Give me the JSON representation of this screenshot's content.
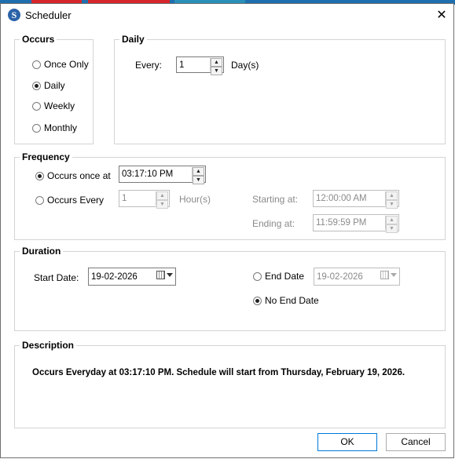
{
  "window": {
    "title": "Scheduler",
    "close_glyph": "✕"
  },
  "occurs": {
    "legend": "Occurs",
    "options": [
      {
        "label": "Once Only",
        "selected": false
      },
      {
        "label": "Daily",
        "selected": true
      },
      {
        "label": "Weekly",
        "selected": false
      },
      {
        "label": "Monthly",
        "selected": false
      }
    ]
  },
  "daily": {
    "legend": "Daily",
    "every_label": "Every:",
    "every_value": "1",
    "unit": "Day(s)"
  },
  "frequency": {
    "legend": "Frequency",
    "once_label": "Occurs once at",
    "once_time": "03:17:10 PM",
    "every_label": "Occurs Every",
    "every_value": "1",
    "every_unit": "Hour(s)",
    "starting_label": "Starting at:",
    "starting_value": "12:00:00 AM",
    "ending_label": "Ending at:",
    "ending_value": "11:59:59 PM"
  },
  "duration": {
    "legend": "Duration",
    "start_label": "Start Date:",
    "start_value": "19-02-2026",
    "end_date_label": "End Date",
    "end_date_value": "19-02-2026",
    "no_end_label": "No End Date"
  },
  "description": {
    "legend": "Description",
    "text": "Occurs Everyday at 03:17:10 PM. Schedule will start from Thursday, February 19, 2026."
  },
  "buttons": {
    "ok": "OK",
    "cancel": "Cancel"
  }
}
